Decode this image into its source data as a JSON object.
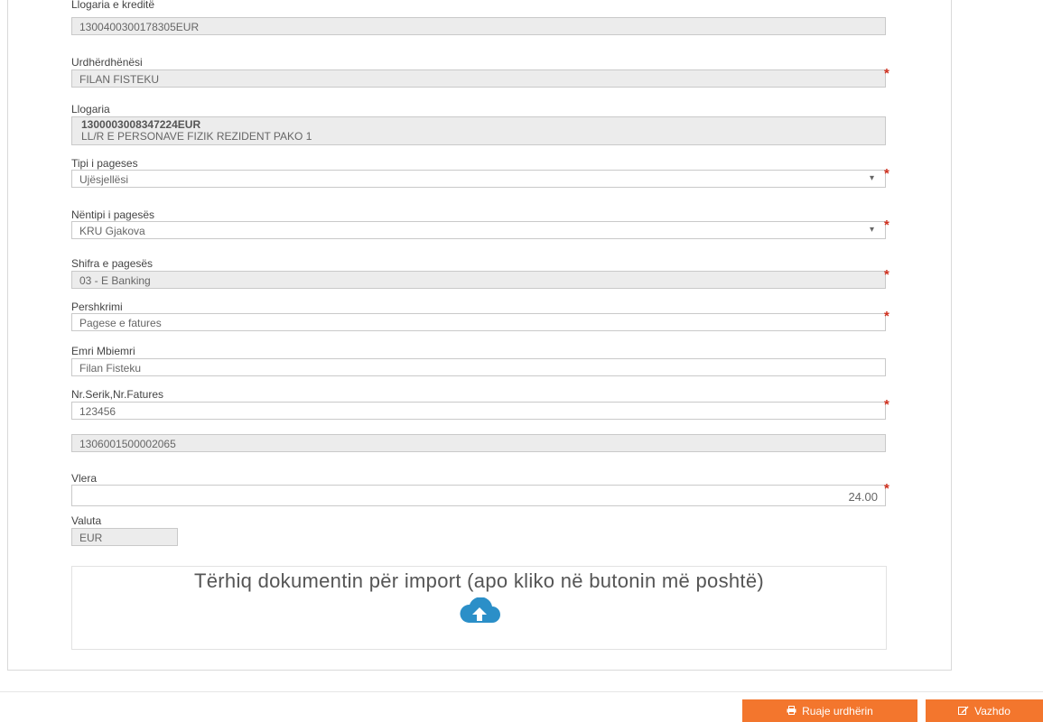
{
  "form": {
    "credit_account": {
      "label": "Llogaria e kreditë",
      "value": "1300400300178305EUR"
    },
    "orderer": {
      "label": "Urdhërdhënësi",
      "value": "FILAN FISTEKU"
    },
    "account": {
      "label": "Llogaria",
      "number": "1300003008347224EUR",
      "name": "LL/R E PERSONAVE FIZIK REZIDENT PAKO 1"
    },
    "payment_type": {
      "label": "Tipi i pageses",
      "value": "Ujësjellësi"
    },
    "payment_subtype": {
      "label": "Nëntipi i pagesës",
      "value": "KRU Gjakova"
    },
    "payment_code": {
      "label": "Shifra e pagesës",
      "value": "03 - E Banking"
    },
    "description": {
      "label": "Pershkrimi",
      "value": "Pagese e fatures"
    },
    "full_name": {
      "label": "Emri Mbiemri",
      "value": "Filan Fisteku"
    },
    "invoice_serial": {
      "label": "Nr.Serik,Nr.Fatures",
      "value": "123456"
    },
    "reference": {
      "value": "1306001500002065"
    },
    "amount": {
      "label": "Vlera",
      "value": "24.00"
    },
    "currency": {
      "label": "Valuta",
      "value": "EUR"
    },
    "required_mark": "*",
    "dropdown_caret": "▾"
  },
  "dropzone": {
    "text": "Tërhiq dokumentin për import (apo kliko në butonin më poshtë)",
    "icon": "cloud-upload-icon"
  },
  "actions": {
    "save_label": "Ruaje urdhërin",
    "continue_label": "Vazhdo",
    "save_icon": "printer-icon",
    "continue_icon": "edit-icon"
  },
  "colors": {
    "accent": "#f3762d",
    "required": "#d0301e",
    "upload_icon": "#2b8fc8"
  }
}
